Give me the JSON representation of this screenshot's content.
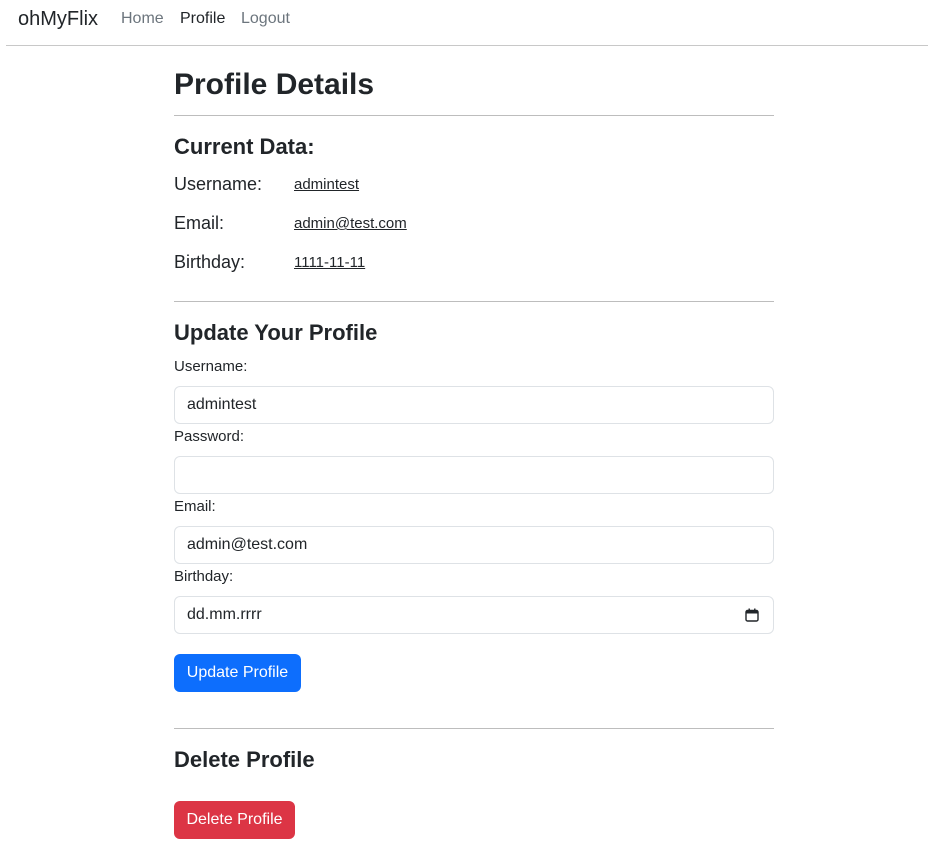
{
  "navbar": {
    "brand": "ohMyFlix",
    "links": [
      "Home",
      "Profile",
      "Logout"
    ]
  },
  "profile": {
    "title": "Profile Details",
    "current": {
      "heading": "Current Data:",
      "username_label": "Username:",
      "username_value": "admintest",
      "email_label": "Email:",
      "email_value": "admin@test.com",
      "birthday_label": "Birthday:",
      "birthday_value": "1111-11-11"
    },
    "update": {
      "heading": "Update Your Profile",
      "username_label": "Username:",
      "username_value": "admintest",
      "password_label": "Password:",
      "password_value": "",
      "email_label": "Email:",
      "email_value": "admin@test.com",
      "birthday_label": "Birthday:",
      "birthday_placeholder": "dd.mm.rrrr",
      "button": "Update Profile"
    },
    "delete": {
      "heading": "Delete Profile",
      "button": "Delete Profile"
    }
  },
  "colors": {
    "primary": "#0d6efd",
    "danger": "#dc3545",
    "text": "#212529",
    "muted": "#6c757d"
  },
  "icons": {
    "birthday_picker": "calendar-icon"
  }
}
